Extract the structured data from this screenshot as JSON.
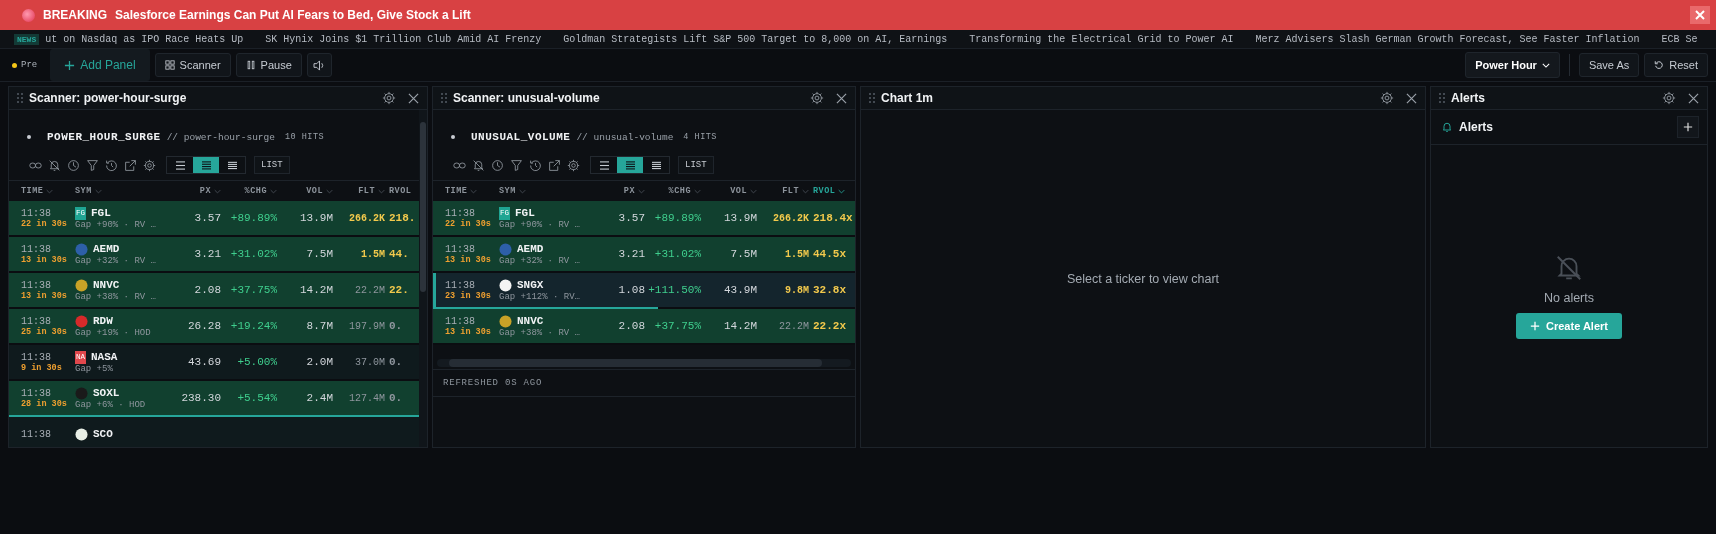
{
  "breaking": {
    "label": "BREAKING",
    "headline": "Salesforce Earnings Can Put AI Fears to Bed, Give Stock a Lift"
  },
  "news": {
    "label": "NEWS",
    "items": [
      "ut on Nasdaq as IPO Race Heats Up",
      "SK Hynix Joins $1 Trillion Club Amid AI Frenzy",
      "Goldman Strategists Lift S&P 500 Target to 8,000 on AI, Earnings",
      "Transforming the Electrical Grid to Power AI",
      "Merz Advisers Slash German Growth Forecast, See Faster Inflation",
      "ECB Se"
    ]
  },
  "toolbar": {
    "session": "Pre",
    "buttons": [
      {
        "kind": "add",
        "label": "Add Panel"
      },
      {
        "kind": "scanner",
        "label": "Scanner"
      },
      {
        "kind": "pause",
        "label": "Pause"
      },
      {
        "kind": "sound"
      }
    ],
    "layout": "Power Hour",
    "right_buttons": [
      {
        "kind": "save",
        "label": "Save As"
      },
      {
        "kind": "reset",
        "label": "Reset"
      }
    ]
  },
  "panels": [
    {
      "kind": "scanner",
      "title": "Scanner: power-hour-surge",
      "name": "POWER_HOUR_SURGE",
      "slug": "// power-hour-surge",
      "hits": "10 HITS",
      "density": [
        {
          "selected": false
        },
        {
          "selected": true
        },
        {
          "selected": false
        }
      ],
      "view": "LIST",
      "columns": [
        {
          "label": "TIME",
          "sorted": false
        },
        {
          "label": "SYM",
          "sorted": false
        },
        {
          "label": "PX",
          "sorted": false
        },
        {
          "label": "%CHG",
          "sorted": false
        },
        {
          "label": "VOL",
          "sorted": false
        },
        {
          "label": "FLT",
          "sorted": false
        },
        {
          "label": "RVOL",
          "sorted": false
        }
      ],
      "rows": [
        {
          "time": "11:38",
          "hits": "22 in 30s",
          "logo": {
            "text": "FG",
            "color": "#1fa593"
          },
          "symbol": "FGL",
          "note": "Gap +90% · RV …",
          "px": "3.57",
          "chg": "+89.89%",
          "vol": "13.9M",
          "flt": "266.2K",
          "flt_hot": true,
          "rvol": "218.",
          "rvol_hot": true,
          "highlighted": true,
          "selected": false
        },
        {
          "time": "11:38",
          "hits": "13 in 30s",
          "logo": {
            "color": "#2d5fa8"
          },
          "symbol": "AEMD",
          "note": "Gap +32% · RV …",
          "px": "3.21",
          "chg": "+31.02%",
          "vol": "7.5M",
          "flt": "1.5M",
          "flt_hot": true,
          "rvol": "44.",
          "rvol_hot": true,
          "highlighted": true,
          "selected": false
        },
        {
          "time": "11:38",
          "hits": "13 in 30s",
          "logo": {
            "color": "#c9a227"
          },
          "symbol": "NNVC",
          "note": "Gap +38% · RV …",
          "px": "2.08",
          "chg": "+37.75%",
          "vol": "14.2M",
          "flt": "22.2M",
          "flt_hot": false,
          "rvol": "22.",
          "rvol_hot": true,
          "highlighted": true,
          "selected": false
        },
        {
          "time": "11:38",
          "hits": "25 in 30s",
          "logo": {
            "color": "#d62a2a"
          },
          "symbol": "RDW",
          "note": "Gap +19% · HOD",
          "px": "26.28",
          "chg": "+19.24%",
          "vol": "8.7M",
          "flt": "197.9M",
          "flt_hot": false,
          "rvol": "0.",
          "rvol_hot": false,
          "highlighted": true,
          "selected": false
        },
        {
          "time": "11:38",
          "hits": "9 in 30s",
          "logo": {
            "text": "NA",
            "color": "#e0474c"
          },
          "symbol": "NASA",
          "note": "Gap +5%",
          "px": "43.69",
          "chg": "+5.00%",
          "vol": "2.0M",
          "flt": "37.0M",
          "flt_hot": false,
          "rvol": "0.",
          "rvol_hot": false,
          "highlighted": false,
          "selected": false
        },
        {
          "time": "11:38",
          "hits": "28 in 30s",
          "logo": {
            "color": "#1a1a1a"
          },
          "symbol": "SOXL",
          "note": "Gap +6% · HOD",
          "px": "238.30",
          "chg": "+5.54%",
          "vol": "2.4M",
          "flt": "127.4M",
          "flt_hot": false,
          "rvol": "0.",
          "rvol_hot": false,
          "highlighted": true,
          "selected": false,
          "level": 1
        },
        {
          "time": "11:38",
          "logo": {
            "color": "#e8efe6"
          },
          "symbol": "SCO",
          "highlighted": false,
          "selected": false
        }
      ]
    },
    {
      "kind": "scanner",
      "title": "Scanner: unusual-volume",
      "name": "UNUSUAL_VOLUME",
      "slug": "// unusual-volume",
      "hits": "4 HITS",
      "density": [
        {
          "selected": false
        },
        {
          "selected": true
        },
        {
          "selected": false
        }
      ],
      "view": "LIST",
      "columns": [
        {
          "label": "TIME",
          "sorted": false
        },
        {
          "label": "SYM",
          "sorted": false
        },
        {
          "label": "PX",
          "sorted": false
        },
        {
          "label": "%CHG",
          "sorted": false
        },
        {
          "label": "VOL",
          "sorted": false
        },
        {
          "label": "FLT",
          "sorted": false
        },
        {
          "label": "RVOL",
          "sorted": true
        }
      ],
      "rows": [
        {
          "time": "11:38",
          "hits": "22 in 30s",
          "logo": {
            "text": "FG",
            "color": "#1fa593"
          },
          "symbol": "FGL",
          "note": "Gap +90% · RV …",
          "px": "3.57",
          "chg": "+89.89%",
          "vol": "13.9M",
          "flt": "266.2K",
          "flt_hot": true,
          "rvol": "218.4x",
          "rvol_hot": true,
          "highlighted": true,
          "selected": false
        },
        {
          "time": "11:38",
          "hits": "13 in 30s",
          "logo": {
            "color": "#2d5fa8"
          },
          "symbol": "AEMD",
          "note": "Gap +32% · RV …",
          "px": "3.21",
          "chg": "+31.02%",
          "vol": "7.5M",
          "flt": "1.5M",
          "flt_hot": true,
          "rvol": "44.5x",
          "rvol_hot": true,
          "highlighted": true,
          "selected": false
        },
        {
          "time": "11:38",
          "hits": "23 in 30s",
          "logo": {
            "color": "#f4f4f4"
          },
          "symbol": "SNGX",
          "note": "Gap +112% · RV…",
          "px": "1.08",
          "chg": "+111.50%",
          "vol": "43.9M",
          "flt": "9.8M",
          "flt_hot": true,
          "rvol": "32.8x",
          "rvol_hot": true,
          "highlighted": false,
          "selected": true,
          "level": 0.52
        },
        {
          "time": "11:38",
          "hits": "13 in 30s",
          "logo": {
            "color": "#c9a227"
          },
          "symbol": "NNVC",
          "note": "Gap +38% · RV …",
          "px": "2.08",
          "chg": "+37.75%",
          "vol": "14.2M",
          "flt": "22.2M",
          "flt_hot": false,
          "rvol": "22.2x",
          "rvol_hot": true,
          "highlighted": true,
          "selected": false
        }
      ],
      "footer": "REFRESHED 0S AGO"
    },
    {
      "kind": "chart",
      "title": "Chart 1m",
      "empty_text": "Select a ticker to view chart"
    },
    {
      "kind": "alerts",
      "title": "Alerts",
      "heading": "Alerts",
      "empty_text": "No alerts",
      "action": "Create Alert"
    }
  ]
}
